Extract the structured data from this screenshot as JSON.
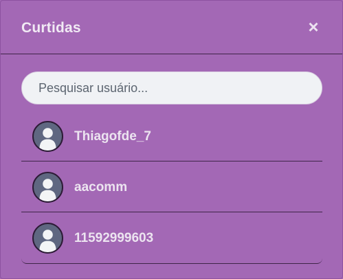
{
  "modal": {
    "title": "Curtidas",
    "close_label": "×"
  },
  "search": {
    "placeholder": "Pesquisar usuário..."
  },
  "users": [
    {
      "name": "Thiagofde_7",
      "avatar_icon": "default-user-avatar-icon"
    },
    {
      "name": "aacomm",
      "avatar_icon": "default-user-avatar-icon"
    },
    {
      "name": "11592999603",
      "avatar_icon": "default-user-avatar-icon"
    }
  ],
  "colors": {
    "background": "#a368b5",
    "divider": "#3e2447",
    "search_bg": "#f0f2f5",
    "avatar_bg": "#5f6781",
    "text_light": "#ece4f0"
  }
}
